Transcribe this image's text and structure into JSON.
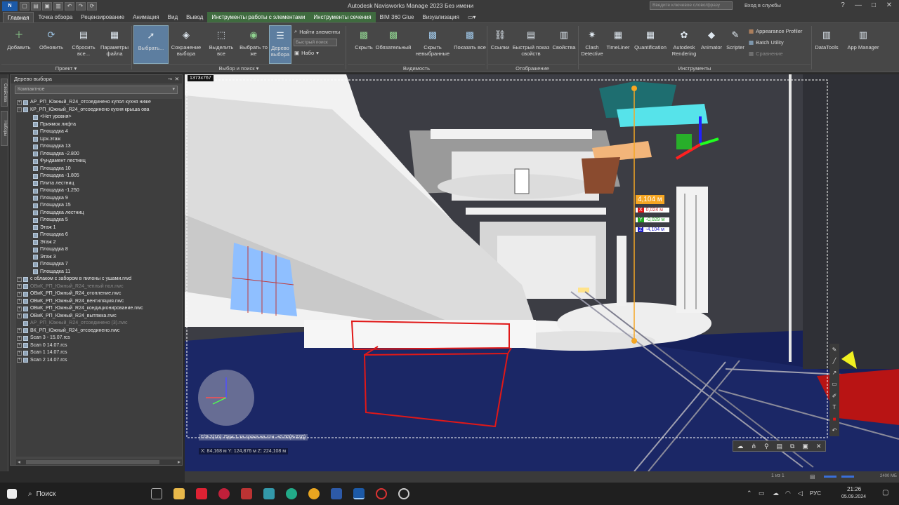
{
  "titlebar": {
    "logo": "N",
    "app_title": "Autodesk Navisworks Manage 2023    Без имени",
    "search_placeholder": "Введите ключевое слово/фразу",
    "user": "Вход в службы",
    "help": "?",
    "minimize": "—",
    "maximize": "□",
    "close": "✕"
  },
  "menu": {
    "tabs": [
      "Главная",
      "Точка обзора",
      "Рецензирование",
      "Анимация",
      "Вид",
      "Вывод",
      "Инструменты работы с элементами",
      "Инструменты сечения",
      "BIM 360 Glue",
      "Визуализация"
    ]
  },
  "ribbon": {
    "project": {
      "add": "Добавить",
      "refresh": "Обновить",
      "reset": "Сбросить все...",
      "params": "Параметры файла",
      "group": "Проект ▾"
    },
    "select": {
      "select": "Выбрать...",
      "save_sel": "Сохранение выбора",
      "select_all": "Выделить все",
      "select_same": "Выбрать то же",
      "tree": "Дерево выбора",
      "find": "Найти элементы",
      "quick_find": "Быстрый поиск",
      "sets": "Набо",
      "group": "Выбор и поиск ▾"
    },
    "visibility": {
      "hide": "Скрыть",
      "required": "Обязательный",
      "hide_unsel": "Скрыть невыбранные",
      "show_all": "Показать все",
      "group": "Видимость"
    },
    "display": {
      "links": "Ссылки",
      "quick_props": "Быстрый показ свойств",
      "props": "Свойства",
      "group": "Отображение"
    },
    "tools": {
      "clash": "Clash Detective",
      "timeliner": "TimeLiner",
      "quant": "Quantification",
      "render": "Autodesk Rendering",
      "animator": "Animator",
      "scripter": "Scripter",
      "appearance": "Appearance Profiler",
      "batch": "Batch Utility",
      "compare": "Сравнение",
      "datatools": "DataTools",
      "appman": "App Manager",
      "group": "Инструменты"
    }
  },
  "left_strip": {
    "tab1": "Свойства",
    "tab2": "Наборы"
  },
  "tree": {
    "title": "Дерево выбора",
    "mode": "Компактное",
    "rows": [
      {
        "exp": "+",
        "label": "АР_РП_Южный_R24_отсоединено купол кухня ниже"
      },
      {
        "exp": "−",
        "label": "КР_РП_Южный_R24_отсоединено кухня крыша ова"
      },
      {
        "exp": "",
        "label": "<Нет уровня>"
      },
      {
        "exp": "",
        "label": "Приямок лифта"
      },
      {
        "exp": "",
        "label": "Площадка 4"
      },
      {
        "exp": "",
        "label": "Цок.этаж"
      },
      {
        "exp": "",
        "label": "Площадка 13"
      },
      {
        "exp": "",
        "label": "Площадка -2.800"
      },
      {
        "exp": "",
        "label": "Фундамент лестниц"
      },
      {
        "exp": "",
        "label": "Площадка 10"
      },
      {
        "exp": "",
        "label": "Площадка -1.805"
      },
      {
        "exp": "",
        "label": "Плита лестниц"
      },
      {
        "exp": "",
        "label": "Площадка -1.250"
      },
      {
        "exp": "",
        "label": "Площадка 9"
      },
      {
        "exp": "",
        "label": "Площадка 15"
      },
      {
        "exp": "",
        "label": "Площадка лестниц"
      },
      {
        "exp": "",
        "label": "Площадка 5"
      },
      {
        "exp": "",
        "label": "Этаж 1"
      },
      {
        "exp": "",
        "label": "Площадка 6"
      },
      {
        "exp": "",
        "label": "Этаж 2"
      },
      {
        "exp": "",
        "label": "Площадка 8"
      },
      {
        "exp": "",
        "label": "Этаж 3"
      },
      {
        "exp": "",
        "label": "Площадка 7"
      },
      {
        "exp": "",
        "label": "Площадка 11"
      },
      {
        "exp": "−",
        "label": "с облаком с забором в пилоны с ушами.nwd"
      },
      {
        "exp": "+",
        "label": "ОВиК_РП_Южный_R24_теплый пол.nwc",
        "dim": true
      },
      {
        "exp": "+",
        "label": "ОВиК_РП_Южный_R24_отопление.nwc"
      },
      {
        "exp": "+",
        "label": "ОВиК_РП_Южный_R24_вентиляция.nwc"
      },
      {
        "exp": "+",
        "label": "ОВиК_РП_Южный_R24_кондиционирование.nwc"
      },
      {
        "exp": "+",
        "label": "ОВиК_РП_Южный_R24_вытяжка.nwc"
      },
      {
        "exp": "",
        "label": "АР_РП_Южный_R24_отсоединено (3).nwc",
        "dim": true
      },
      {
        "exp": "+",
        "label": "ВК_РП_Южный_R24_отсоединено.nwc"
      },
      {
        "exp": "+",
        "label": "Scan 3 - 15.07.rcs"
      },
      {
        "exp": "+",
        "label": "Scan 0 14.07.rcs"
      },
      {
        "exp": "+",
        "label": "Scan 1 14.07.rcs"
      },
      {
        "exp": "+",
        "label": "Scan 2 14.07.rcs"
      }
    ]
  },
  "viewport": {
    "capture_size": "1373x767",
    "measure_total": "4,104 м",
    "measure_x": "0,024 м",
    "measure_y": "-0,029 м",
    "measure_z": "-4,104 м",
    "axis_x": "X",
    "axis_y": "Y",
    "axis_z": "Z",
    "status_line": "Г/Э 2(10): Пдж 1 за срока на стн. +0.00(8-22Д)",
    "coords": "X: 84,168 м  Y: 124,876 м  Z: 224,108 м"
  },
  "statusbar": {
    "page": "1 из 1",
    "memory": "2400 МБ"
  },
  "taskbar": {
    "search": "Поиск",
    "lang": "РУС",
    "time": "21:26",
    "date": "05.09.2024"
  }
}
